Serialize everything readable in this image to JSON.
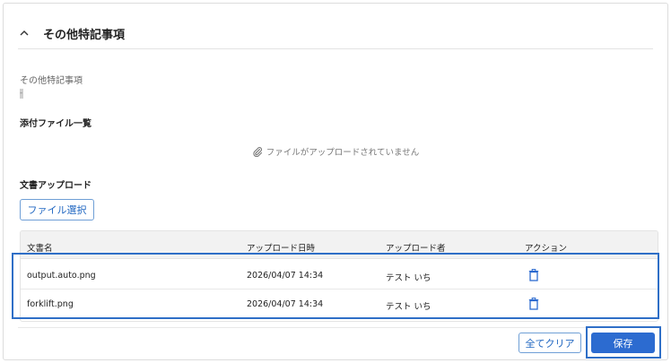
{
  "section": {
    "title": "その他特記事項",
    "collapse_icon": "chevron-up-icon"
  },
  "notes_field": {
    "label": "その他特記事項",
    "value": "-"
  },
  "attachments": {
    "title": "添付ファイル一覧",
    "empty_message": "ファイルがアップロードされていません",
    "empty_icon": "paperclip-icon"
  },
  "upload": {
    "title": "文書アップロード",
    "select_button": "ファイル選択"
  },
  "table": {
    "headers": [
      "文書名",
      "アップロード日時",
      "アップロード者",
      "アクション"
    ],
    "rows": [
      {
        "name": "output.auto.png",
        "datetime": "2026/04/07 14:34",
        "uploader": "テスト いち",
        "action_icon": "trash-icon"
      },
      {
        "name": "forklift.png",
        "datetime": "2026/04/07 14:34",
        "uploader": "テスト いち",
        "action_icon": "trash-icon"
      }
    ]
  },
  "footer": {
    "clear_button": "全てクリア",
    "save_button": "保存"
  },
  "colors": {
    "accent": "#2c6bd0",
    "highlight": "#2f6fc7",
    "header_bg": "#f2f2f2"
  }
}
